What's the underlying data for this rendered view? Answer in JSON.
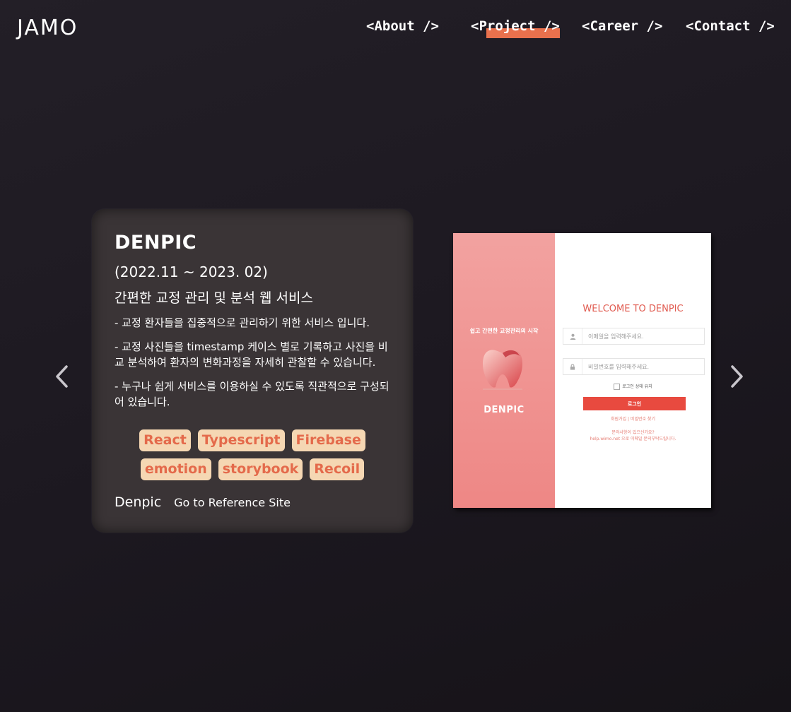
{
  "header": {
    "logo": "JAMO",
    "nav": [
      {
        "label": "<About />"
      },
      {
        "label": "<Project />",
        "active": true
      },
      {
        "label": "<Career />"
      },
      {
        "label": "<Contact />"
      }
    ]
  },
  "project": {
    "title": "DENPIC",
    "period": "(2022.11 ~ 2023. 02)",
    "subtitle": "간편한 교정 관리 및 분석 웹 서비스",
    "descriptions": [
      "- 교정 환자들을 집중적으로 관리하기 위한 서비스 입니다.",
      "- 교정 사진들을 timestamp 케이스 별로 기록하고 사진을 비교 분석하여 환자의 변화과정을 자세히 관찰할 수 있습니다.",
      "- 누구나 쉽게 서비스를 이용하실 수 있도록 직관적으로 구성되어 있습니다."
    ],
    "tags": [
      "React",
      "Typescript",
      "Firebase",
      "emotion",
      "storybook",
      "Recoil"
    ],
    "brand": "Denpic",
    "reference_link": "Go to Reference Site"
  },
  "preview": {
    "tagline": "쉽고 간편한 교정관리의 시작",
    "brand": "DENPIC",
    "welcome": "WELCOME TO DENPIC",
    "email_placeholder": "이메일을 입력해주세요.",
    "password_placeholder": "비밀번호를 입력해주세요.",
    "keep_login": "로그인 상태 유지",
    "login_button": "로그인",
    "links": "회원가입 | 비밀번호 찾기",
    "contact_line1": "문의사항이 있으신가요?",
    "contact_line2": "help.wimo.net 으로 이메일 문의부탁드립니다."
  },
  "colors": {
    "accent": "#e9714d",
    "tag_bg": "#f5d7b3",
    "tag_text": "#e46a4b",
    "card_bg": "#3a3436"
  },
  "icons": {
    "prev": "chevron-left-icon",
    "next": "chevron-right-icon"
  }
}
